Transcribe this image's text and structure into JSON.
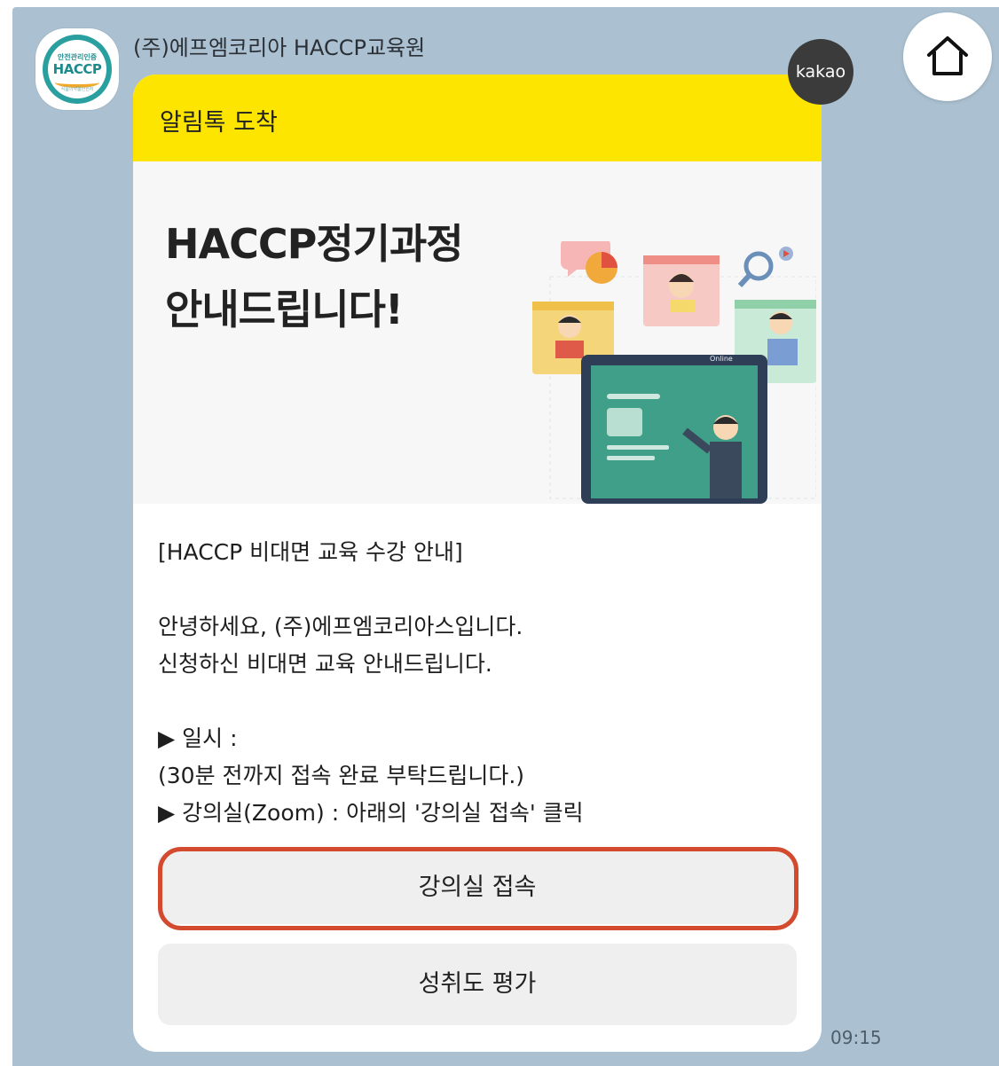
{
  "sender": {
    "name": "(주)에프엠코리아 HACCP교육원"
  },
  "avatar": {
    "text_top": "안전관리인증",
    "text_main": "HACCP",
    "text_bottom": "식품의약품안전처"
  },
  "badge": {
    "label": "kakao"
  },
  "card": {
    "header_label": "알림톡 도착",
    "banner_title_line1": "HACCP정기과정",
    "banner_title_line2": "안내드립니다!",
    "illustration_text": "Online",
    "lines": [
      "[HACCP  비대면 교육 수강 안내]",
      "안녕하세요, (주)에프엠코리아스입니다.",
      "신청하신 비대면 교육 안내드립니다.",
      "▶ 일시 :",
      "(30분 전까지 접속 완료 부탁드립니다.)",
      "▶ 강의실(Zoom) : 아래의 '강의실 접속' 클릭"
    ],
    "buttons": {
      "classroom": "강의실 접속",
      "evaluation": "성취도 평가"
    }
  },
  "message": {
    "time": "09:15"
  },
  "colors": {
    "chat_bg": "#abc1d1",
    "header_yellow": "#fee500",
    "highlight": "#d44a2e",
    "badge_bg": "#3b3b3b"
  },
  "icons": {
    "home": "home-icon"
  }
}
